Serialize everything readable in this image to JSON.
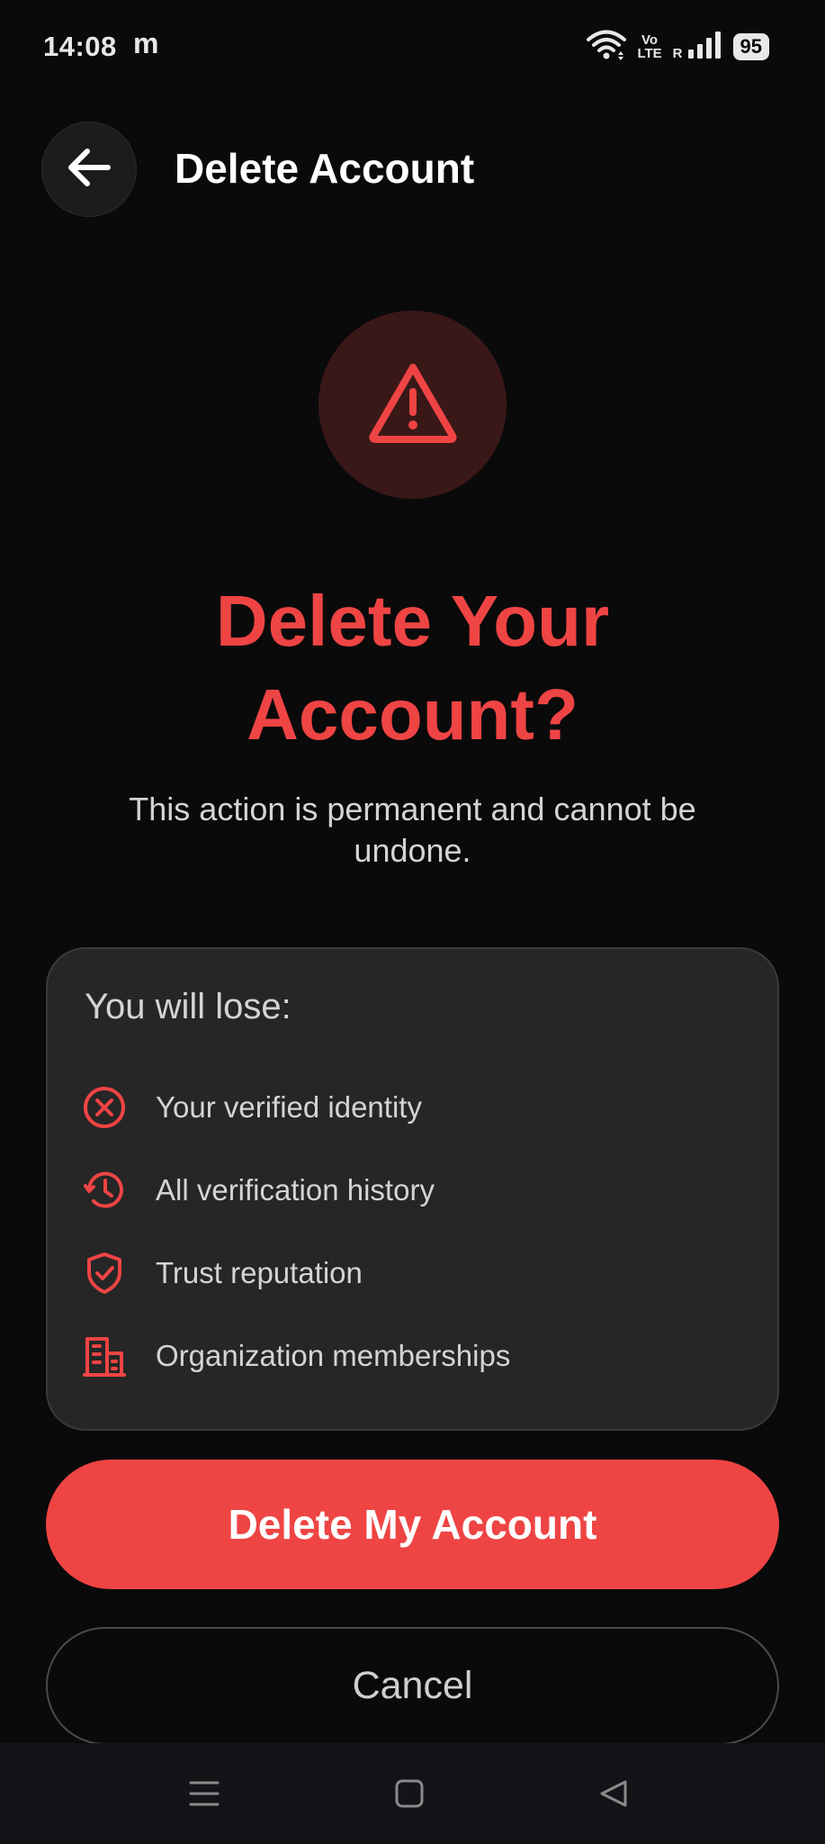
{
  "status_bar": {
    "time": "14:08",
    "app_indicator": "m",
    "volte_top": "Vo",
    "volte_bottom": "LTE",
    "roaming": "R",
    "battery": "95",
    "icons": [
      "wifi-icon",
      "signal-icon"
    ]
  },
  "header": {
    "title": "Delete Account",
    "back_icon": "arrow-left-icon"
  },
  "warning": {
    "icon": "warning-triangle-icon",
    "title_line1": "Delete Your",
    "title_line2": "Account?",
    "subtitle": "This action is permanent and cannot be undone."
  },
  "loss_card": {
    "heading": "You will lose:",
    "items": [
      {
        "icon": "x-circle-icon",
        "label": "Your verified identity"
      },
      {
        "icon": "history-icon",
        "label": "All verification history"
      },
      {
        "icon": "shield-check-icon",
        "label": "Trust reputation"
      },
      {
        "icon": "building-icon",
        "label": "Organization memberships"
      }
    ]
  },
  "actions": {
    "delete_label": "Delete My Account",
    "cancel_label": "Cancel"
  },
  "nav_bar": {
    "icons": [
      "menu-icon",
      "home-icon",
      "back-icon"
    ]
  },
  "colors": {
    "background": "#0a0a0a",
    "accent": "#ef4444",
    "card": "#262626",
    "warning_circle": "#3a1818"
  }
}
